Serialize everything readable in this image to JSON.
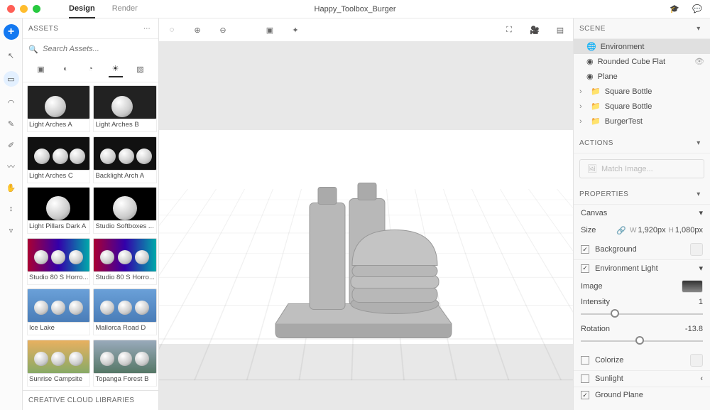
{
  "title": "Happy_Toolbox_Burger",
  "tabs": {
    "design": "Design",
    "render": "Render"
  },
  "assets": {
    "header": "ASSETS",
    "search_placeholder": "Search Assets...",
    "items": [
      "Light Arches A",
      "Light Arches B",
      "Light Arches C",
      "Backlight Arch A",
      "Light Pillars Dark A",
      "Studio Softboxes ...",
      "Studio 80 S Horro...",
      "Studio 80 S Horro...",
      "Ice Lake",
      "Mallorca Road D",
      "Sunrise Campsite",
      "Topanga Forest B"
    ],
    "ccl": "CREATIVE CLOUD LIBRARIES"
  },
  "scene": {
    "header": "SCENE",
    "items": [
      {
        "label": "Environment",
        "selected": true,
        "icon": "globe"
      },
      {
        "label": "Rounded Cube Flat",
        "icon": "sphere"
      },
      {
        "label": "Plane",
        "icon": "sphere"
      },
      {
        "label": "Square Bottle",
        "icon": "folder",
        "expandable": true
      },
      {
        "label": "Square Bottle",
        "icon": "folder",
        "expandable": true
      },
      {
        "label": "BurgerTest",
        "icon": "folder",
        "expandable": true
      }
    ]
  },
  "actions": {
    "header": "ACTIONS",
    "match": "Match Image..."
  },
  "props": {
    "header": "PROPERTIES",
    "canvas": "Canvas",
    "size_label": "Size",
    "width": "1,920px",
    "height": "1,080px",
    "background": "Background",
    "env_light": "Environment Light",
    "image": "Image",
    "intensity_label": "Intensity",
    "intensity_val": "1",
    "rotation_label": "Rotation",
    "rotation_val": "-13.8",
    "colorize": "Colorize",
    "sunlight": "Sunlight",
    "ground_plane": "Ground Plane"
  }
}
